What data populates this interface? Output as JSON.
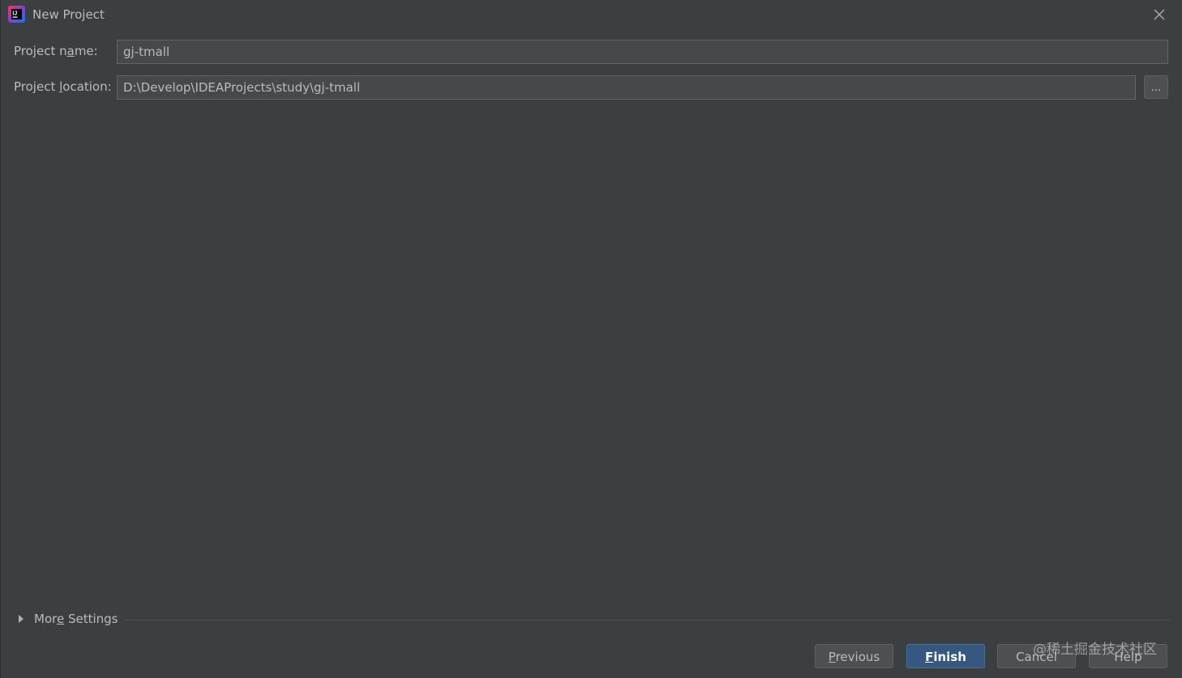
{
  "window": {
    "title": "New Project",
    "app_icon": "intellij-idea-icon",
    "close_icon": "close-icon"
  },
  "form": {
    "project_name": {
      "label_before": "Project n",
      "label_mnemonic": "a",
      "label_after": "me:",
      "value": "gj-tmall"
    },
    "project_location": {
      "label_before": "Project ",
      "label_mnemonic": "l",
      "label_after": "ocation:",
      "value": "D:\\Develop\\IDEAProjects\\study\\gj-tmall",
      "browse_label": "..."
    }
  },
  "more_settings": {
    "label_before": "Mor",
    "label_mnemonic": "e",
    "label_after": " Settings",
    "expanded": false,
    "icon": "triangle-right-icon"
  },
  "buttons": {
    "previous": {
      "mnemonic": "P",
      "rest": "revious"
    },
    "finish": {
      "mnemonic": "F",
      "rest": "inish"
    },
    "cancel": {
      "label": "Cancel"
    },
    "help": {
      "label": "Help"
    }
  },
  "watermark": "@稀土掘金技术社区",
  "colors": {
    "background": "#3c3f41",
    "field_background": "#45494a",
    "primary_button": "#365880",
    "text": "#bbbbbb"
  }
}
